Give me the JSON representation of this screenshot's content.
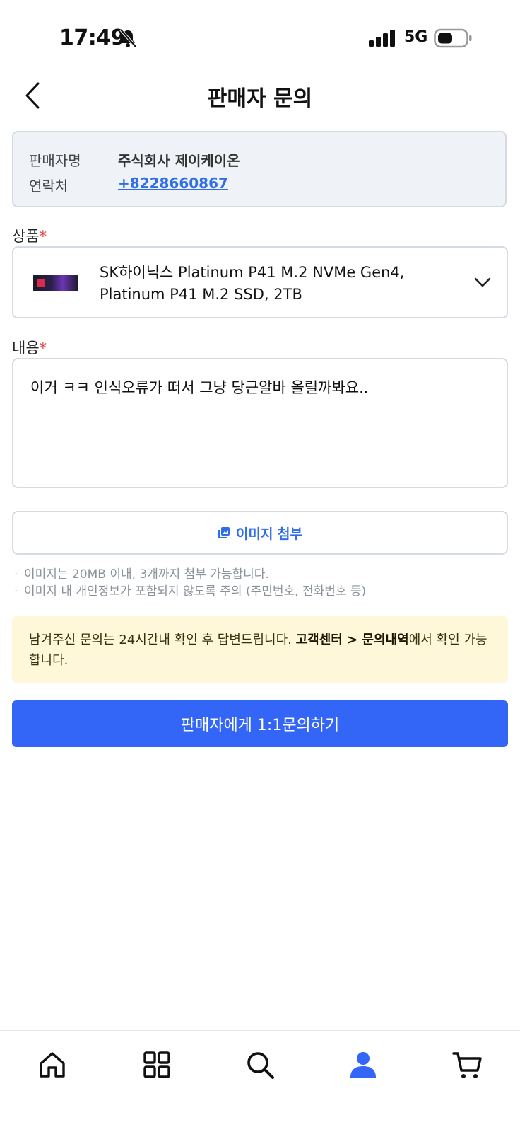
{
  "status_bar": {
    "time": "17:49",
    "network": "5G",
    "icons": [
      "bell-muted-icon",
      "signal-icon",
      "battery-icon"
    ]
  },
  "header": {
    "title": "판매자 문의",
    "back_icon": "chevron-left-icon"
  },
  "seller": {
    "name_label": "판매자명",
    "name_value": "주식회사 제이케이온",
    "contact_label": "연락처",
    "contact_value": "+8228660867"
  },
  "product": {
    "label": "상품",
    "required_mark": "*",
    "name": "SK하이닉스 Platinum P41 M.2 NVMe Gen4, Platinum P41 M.2 SSD, 2TB",
    "dropdown_icon": "chevron-down-icon"
  },
  "content": {
    "label": "내용",
    "required_mark": "*",
    "value": "이거 ㅋㅋ 인식오류가 떠서 그냥 당근알바 올릴까봐요.."
  },
  "attach": {
    "label": "이미지 첨부",
    "icon": "image-icon",
    "notes": [
      "이미지는 20MB 이내, 3개까지 첨부 가능합니다.",
      "이미지 내 개인정보가 포함되지 않도록 주의 (주민번호, 전화번호 등)"
    ]
  },
  "notice": {
    "prefix": "남겨주신 문의는 24시간내 확인 후 답변드립니다. ",
    "emphasis": "고객센터 > 문의내역",
    "suffix": "에서 확인 가능합니다."
  },
  "submit": {
    "label": "판매자에게 1:1문의하기"
  },
  "tab_bar": {
    "items": [
      "home-icon",
      "categories-icon",
      "search-icon",
      "my-account-icon",
      "cart-icon"
    ],
    "active": "my-account-icon"
  },
  "colors": {
    "accent": "#3366f7",
    "link": "#2f6ee8",
    "required": "#e53935",
    "notice_bg": "#fef7da",
    "seller_bg": "#eff3f7"
  }
}
